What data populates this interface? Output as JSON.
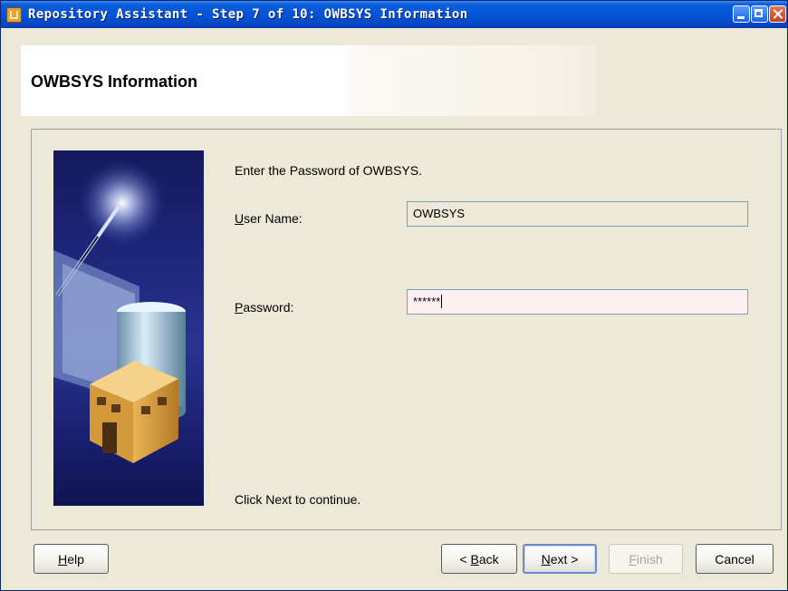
{
  "window": {
    "title": "Repository Assistant - Step 7 of 10: OWBSYS Information"
  },
  "header": {
    "title": "OWBSYS Information"
  },
  "form": {
    "instruction": "Enter the Password of OWBSYS.",
    "user_name_label_first": "U",
    "user_name_label_rest": "ser Name:",
    "user_name_value": "OWBSYS",
    "password_label_first": "P",
    "password_label_rest": "assword:",
    "password_value": "******",
    "continue_hint": "Click Next to continue."
  },
  "buttons": {
    "help_first": "H",
    "help_rest": "elp",
    "back_prefix": "< ",
    "back_first": "B",
    "back_rest": "ack",
    "next_first": "N",
    "next_rest": "ext >",
    "finish_first": "F",
    "finish_rest": "inish",
    "cancel": "Cancel"
  }
}
